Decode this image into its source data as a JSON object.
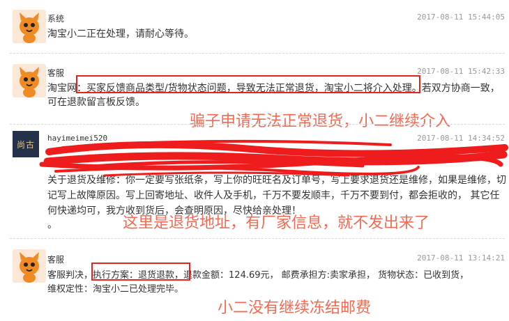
{
  "messages": [
    {
      "sender": "系统",
      "time": "2017-08-11 15:44:05",
      "lines": [
        "淘宝小二正在处理，请耐心等待。"
      ]
    },
    {
      "sender": "客服",
      "time": "2017-08-11 15:42:33",
      "lines": [
        "淘宝网：买家反馈商品类型/货物状态问题，导致无法正常退货，淘宝小二将介入处理。若双方协商一致，",
        "可在退款留言板反馈。"
      ],
      "line1_prefix": "淘宝网：",
      "line1_highlight": "买家反馈商品类型/货物状态问题，导致无法正常退货，淘宝小二将介入处理。",
      "line1_suffix": "若双方协商一致，"
    },
    {
      "sender": "hayimeimei520",
      "avatar_text": "尚古",
      "time": "2017-08-11 14:34:52",
      "lines": [
        "关于退货及维修：你一定要写张纸条，写上你的旺旺名及订单号，写上要求退货还是维修，如果是维修，切",
        "记写上故障原因。写上回寄地址、收件人及手机，千万不要发顺丰，千万不要到付，都会拒收的， 其它任",
        "何快递均可，我方收到货后，会查明原因，尽快给亲处理！",
        "。"
      ]
    },
    {
      "sender": "客服",
      "time": "2017-08-11 13:14:21",
      "line1_prefix": "客服判决，",
      "line1_highlight": "执行方案：退货退款",
      "line1_suffix": "，退款金额：124.69元， 邮费承担方:卖家承担， 货物状态：已收到货，",
      "lines": [
        "维权定性：淘宝小二已处理完毕。"
      ]
    }
  ],
  "annotations": {
    "a1": "骗子申请无法正常退货，小二继续介入",
    "a2": "这里是退货地址，有厂家信息，就不发出来了",
    "a3": "小二没有继续冻结邮费"
  },
  "colors": {
    "highlight_box": "#e3231e",
    "annotation_text": "#f26a53",
    "scribble": "#ee1c1c",
    "avatar_orange": "#f08a24"
  }
}
